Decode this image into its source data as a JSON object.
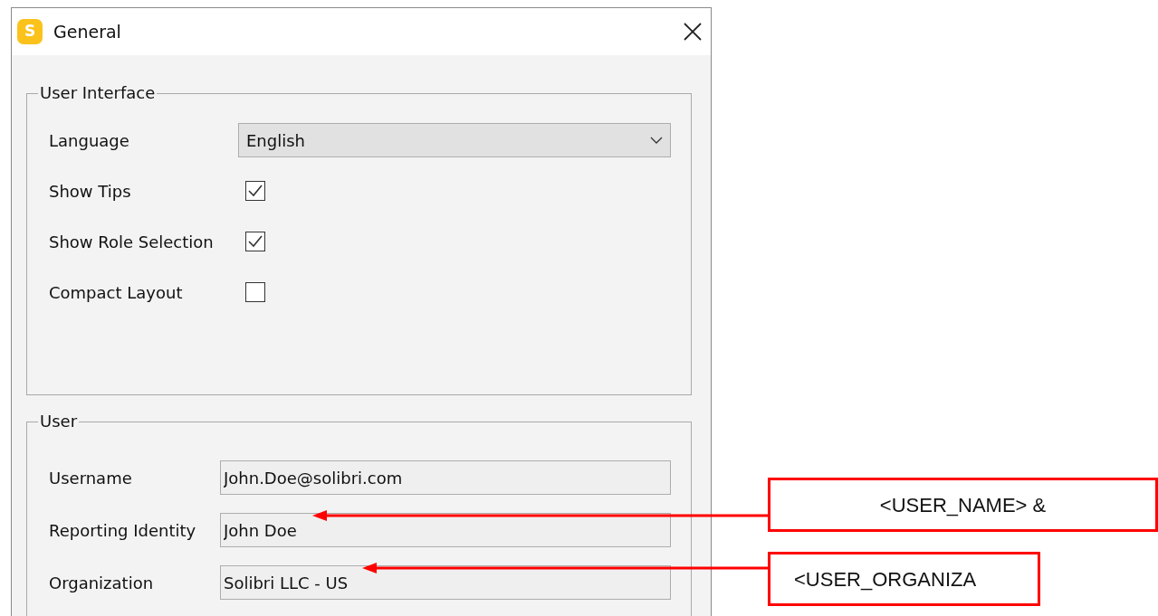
{
  "window": {
    "app_icon": "S",
    "title": "General"
  },
  "groups": [
    {
      "title": "User Interface",
      "fields": [
        {
          "kind": "dropdown",
          "label": "Language",
          "value": "English"
        },
        {
          "kind": "checkbox",
          "label": "Show Tips",
          "checked": true
        },
        {
          "kind": "checkbox",
          "label": "Show Role Selection",
          "checked": true
        },
        {
          "kind": "checkbox",
          "label": "Compact Layout",
          "checked": false
        }
      ]
    },
    {
      "title": "User",
      "fields": [
        {
          "kind": "text",
          "label": "Username",
          "value": "John.Doe@solibri.com"
        },
        {
          "kind": "text",
          "label": "Reporting Identity",
          "value": "John Doe"
        },
        {
          "kind": "text",
          "label": "Organization",
          "value": "Solibri LLC - US"
        }
      ]
    }
  ],
  "annotations": [
    {
      "text": "<USER_NAME> &"
    },
    {
      "text": "<USER_ORGANIZA"
    }
  ]
}
